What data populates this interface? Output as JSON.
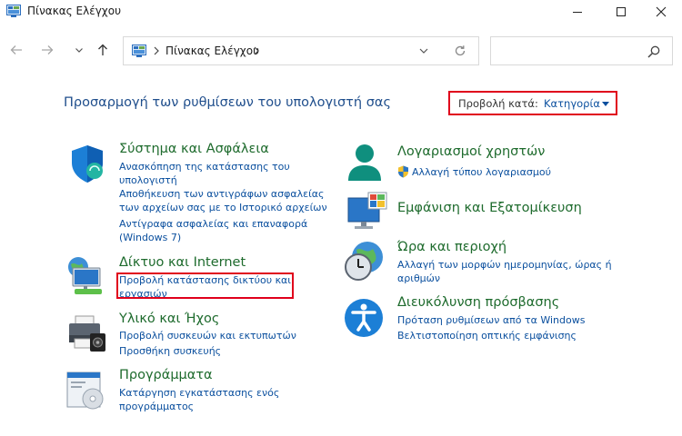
{
  "window": {
    "title": "Πίνακας Ελέγχου"
  },
  "address": {
    "path": "Πίνακας Ελέγχου"
  },
  "search": {
    "placeholder": ""
  },
  "header": {
    "title": "Προσαρμογή των ρυθμίσεων του υπολογιστή σας",
    "view_by_label": "Προβολή κατά:",
    "view_by_value": "Κατηγορία"
  },
  "categories": {
    "system": {
      "icon": "shield-icon",
      "title": "Σύστημα και Ασφάλεια",
      "links": [
        [
          "Ανασκόπηση της κατάστασης του",
          "υπολογιστή"
        ],
        [
          "Αποθήκευση των αντιγράφων ασφαλείας",
          "των αρχείων σας με το Ιστορικό αρχείων"
        ],
        [
          "Αντίγραφα ασφαλείας και επαναφορά",
          "(Windows 7)"
        ]
      ]
    },
    "network": {
      "icon": "network-globe-icon",
      "title": "Δίκτυο και Internet",
      "links": [
        [
          "Προβολή κατάστασης δικτύου και",
          "εργασιών"
        ]
      ]
    },
    "hardware": {
      "icon": "printer-icon",
      "title": "Υλικό και Ήχος",
      "links": [
        [
          "Προβολή συσκευών και εκτυπωτών"
        ],
        [
          "Προσθήκη συσκευής"
        ]
      ]
    },
    "programs": {
      "icon": "programs-icon",
      "title": "Προγράμματα",
      "links": [
        [
          "Κατάργηση εγκατάστασης ενός",
          "προγράμματος"
        ]
      ]
    },
    "accounts": {
      "icon": "user-icon",
      "title": "Λογαριασμοί χρηστών",
      "links": [
        [
          "Αλλαγή τύπου λογαριασμού"
        ]
      ]
    },
    "appearance": {
      "icon": "appearance-icon",
      "title": "Εμφάνιση και Εξατομίκευση",
      "links": []
    },
    "clock": {
      "icon": "clock-globe-icon",
      "title": "Ώρα και περιοχή",
      "links": [
        [
          "Αλλαγή των μορφών ημερομηνίας, ώρας ή",
          "αριθμών"
        ]
      ]
    },
    "access": {
      "icon": "accessibility-icon",
      "title": "Διευκόλυνση πρόσβασης",
      "links": [
        [
          "Πρόταση ρυθμίσεων από τα Windows"
        ],
        [
          "Βελτιστοποίηση οπτικής εμφάνισης"
        ]
      ]
    }
  },
  "colors": {
    "title_green": "#1e6b2d",
    "link_blue": "#0a4f9e",
    "highlight_red": "#e0001b"
  }
}
